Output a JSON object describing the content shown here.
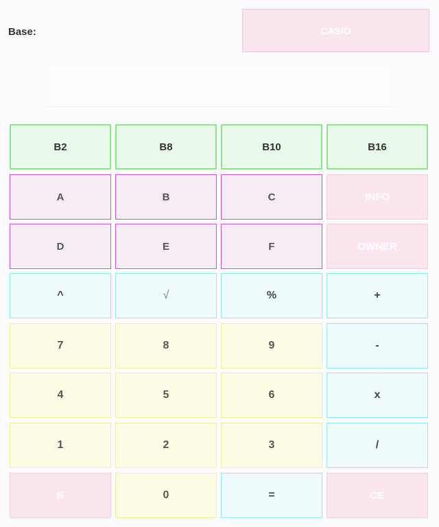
{
  "header": {
    "base_label": "Base:",
    "brand_button": "CASIO"
  },
  "display": {
    "value": ""
  },
  "rows": {
    "bases": [
      "B2",
      "B8",
      "B10",
      "B16"
    ],
    "hex1": [
      "A",
      "B",
      "C",
      "INFO"
    ],
    "hex2": [
      "D",
      "E",
      "F",
      "OWNER"
    ],
    "ops": [
      "^",
      "√",
      "%",
      "+"
    ],
    "r789": [
      "7",
      "8",
      "9",
      "-"
    ],
    "r456": [
      "4",
      "5",
      "6",
      "x"
    ],
    "r123": [
      "1",
      "2",
      "3",
      "/"
    ],
    "last": [
      "R",
      "0",
      "=",
      "CE"
    ]
  }
}
